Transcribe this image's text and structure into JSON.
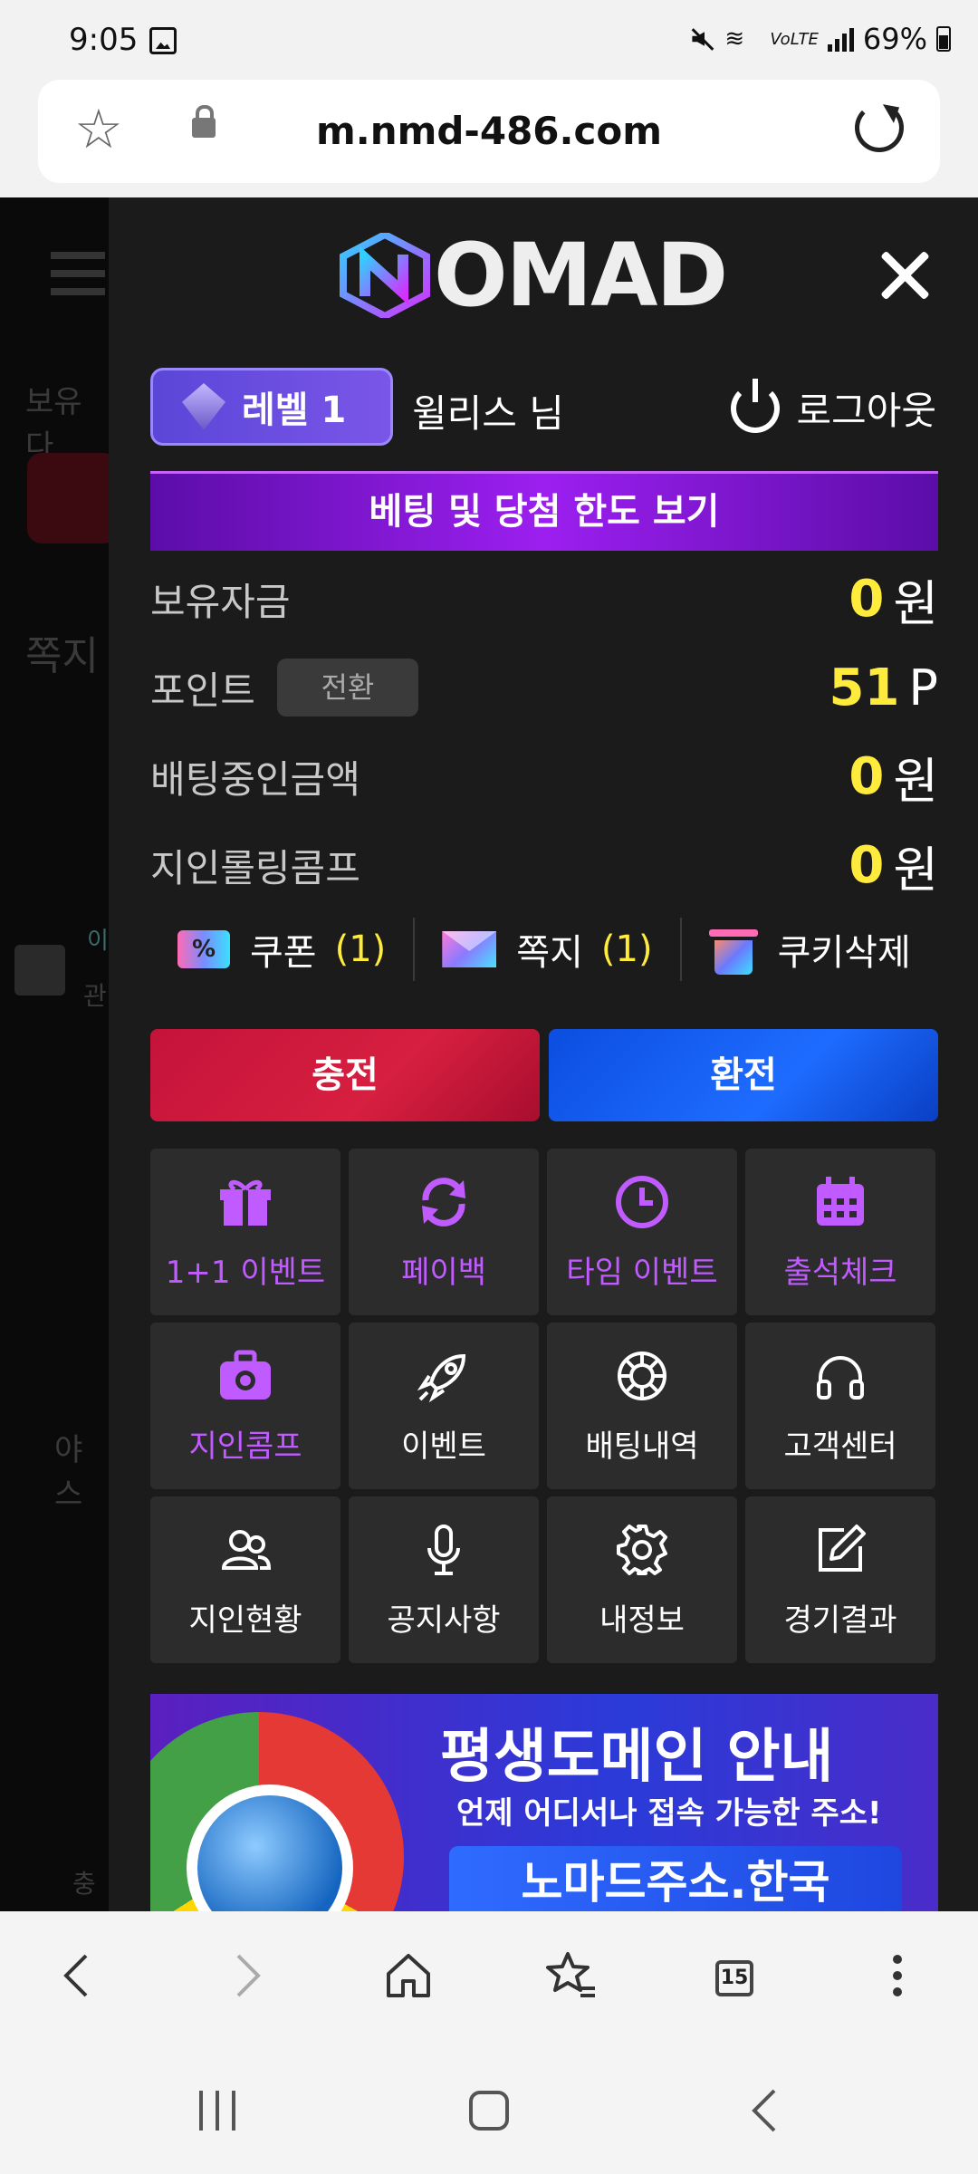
{
  "status_bar": {
    "time": "9:05",
    "battery": "69%",
    "network": "VoLTE"
  },
  "browser": {
    "url": "m.nmd-486.com"
  },
  "background_page": {
    "texts": [
      "보유다",
      "쪽지",
      "이",
      "관",
      "야스",
      "충"
    ]
  },
  "drawer": {
    "logo": {
      "text": "OMAD"
    },
    "level": "레벨 1",
    "username": "윌리스 님",
    "logout": "로그아웃",
    "limit_button": "베팅 및 당첨 한도 보기",
    "balances": [
      {
        "label": "보유자금",
        "value": "0",
        "unit": "원"
      },
      {
        "label": "포인트",
        "value": "51",
        "unit": "P",
        "action": "전환"
      },
      {
        "label": "배팅중인금액",
        "value": "0",
        "unit": "원"
      },
      {
        "label": "지인롤링콤프",
        "value": "0",
        "unit": "원"
      }
    ],
    "shortcuts": {
      "coupon": {
        "label": "쿠폰",
        "count": "(1)",
        "icon_glyph": "%"
      },
      "message": {
        "label": "쪽지",
        "count": "(1)"
      },
      "cookie": {
        "label": "쿠키삭제"
      }
    },
    "charge": "충전",
    "exchange": "환전",
    "menu": [
      {
        "label": "1+1 이벤트",
        "icon": "gift-icon",
        "accent": true
      },
      {
        "label": "페이백",
        "icon": "refresh-icon",
        "accent": true
      },
      {
        "label": "타임 이벤트",
        "icon": "clock-icon",
        "accent": true
      },
      {
        "label": "출석체크",
        "icon": "calendar-icon",
        "accent": true
      },
      {
        "label": "지인콤프",
        "icon": "briefcase-icon",
        "accent": true
      },
      {
        "label": "이벤트",
        "icon": "rocket-icon",
        "accent": false
      },
      {
        "label": "배팅내역",
        "icon": "life-ring-icon",
        "accent": false
      },
      {
        "label": "고객센터",
        "icon": "headphones-icon",
        "accent": false
      },
      {
        "label": "지인현황",
        "icon": "users-icon",
        "accent": false
      },
      {
        "label": "공지사항",
        "icon": "microphone-icon",
        "accent": false
      },
      {
        "label": "내정보",
        "icon": "gear-icon",
        "accent": false
      },
      {
        "label": "경기결과",
        "icon": "edit-icon",
        "accent": false
      }
    ],
    "banner": {
      "title": "평생도메인 안내",
      "subtitle": "언제 어디서나 접속 가능한 주소!",
      "address": "노마드주소.한국"
    }
  },
  "nav": {
    "tab_count": "15"
  },
  "colors": {
    "accent_purple": "#c05cff",
    "value_yellow": "#ffeb3b",
    "charge_red": "#d71f40",
    "exchange_blue": "#1e6cff"
  }
}
